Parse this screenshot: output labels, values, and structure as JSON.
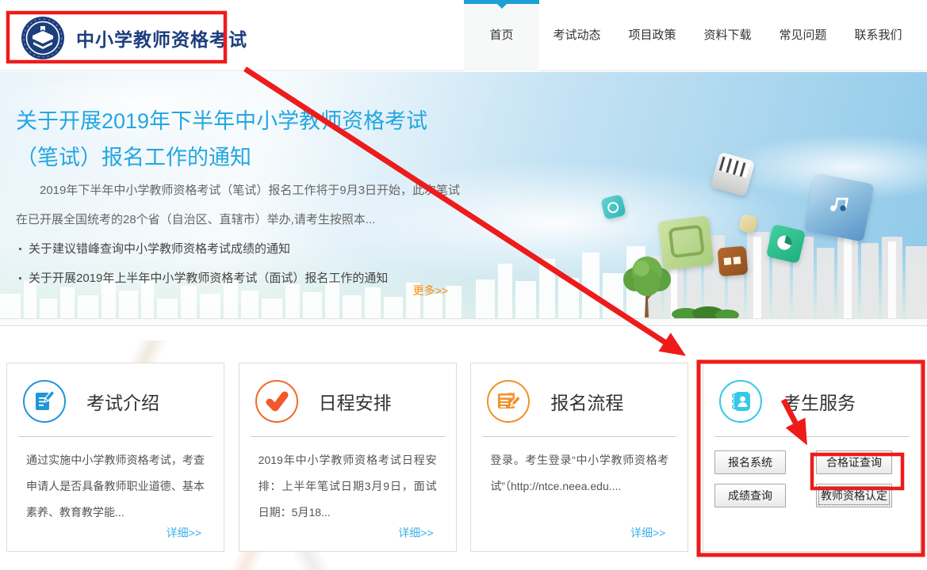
{
  "header": {
    "logo_text": "中小学教师资格考试"
  },
  "nav": {
    "items": [
      {
        "label": "首页",
        "active": true
      },
      {
        "label": "考试动态",
        "active": false
      },
      {
        "label": "项目政策",
        "active": false
      },
      {
        "label": "资料下载",
        "active": false
      },
      {
        "label": "常见问题",
        "active": false
      },
      {
        "label": "联系我们",
        "active": false
      }
    ]
  },
  "banner": {
    "title": "关于开展2019年下半年中小学教师资格考试（笔试）报名工作的通知",
    "summary": "2019年下半年中小学教师资格考试（笔试）报名工作将于9月3日开始，此次笔试在已开展全国统考的28个省（自治区、直辖市）举办,请考生按照本...",
    "news": [
      {
        "title": "关于建议错峰查询中小学教师资格考试成绩的通知"
      },
      {
        "title": "关于开展2019年上半年中小学教师资格考试（面试）报名工作的通知"
      }
    ],
    "more_label": "更多>>"
  },
  "cards": [
    {
      "title": "考试介绍",
      "icon": "document-pen-icon",
      "accent": "#2196d9",
      "text": "通过实施中小学教师资格考试，考查申请人是否具备教师职业道德、基本素养、教育教学能...",
      "link_label": "详细>>"
    },
    {
      "title": "日程安排",
      "icon": "checkmark-icon",
      "accent": "#f2682a",
      "text": "2019年中小学教师资格考试日程安排：上半年笔试日期3月9日，面试日期：5月18...",
      "link_label": "详细>>"
    },
    {
      "title": "报名流程",
      "icon": "browser-pencil-icon",
      "accent": "#f0922c",
      "text": "登录。考生登录“中小学教师资格考试”（http://ntce.neea.edu....",
      "link_label": "详细>>"
    },
    {
      "title": "考生服务",
      "icon": "contact-book-icon",
      "accent": "#35c8e8",
      "buttons": [
        "报名系统",
        "合格证查询",
        "成绩查询",
        "教师资格认定"
      ]
    }
  ],
  "annotations": {
    "highlight_color": "#ee1b1b",
    "highlighted_items": [
      "logo",
      "考生服务 card",
      "合格证查询 button"
    ]
  },
  "colors": {
    "nav_active_blue": "#1e9fd6",
    "banner_title_blue": "#23a7e0",
    "link_blue": "#3cb0e8",
    "more_orange": "#ff8800",
    "logo_navy": "#1d3e7d",
    "annotation_red": "#ee1b1b"
  }
}
